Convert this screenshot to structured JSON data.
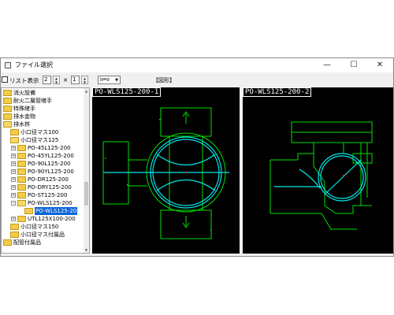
{
  "window": {
    "title": "ファイル選択",
    "minimize": "—",
    "maximize": "☐",
    "close": "✕"
  },
  "toolbar": {
    "list_view_label": "リスト表示",
    "columns": "2",
    "times": "×",
    "rows": "1",
    "format": "jpeg",
    "figure_label": "【図形】"
  },
  "tree": [
    {
      "label": "消火設備",
      "level": 0
    },
    {
      "label": "耐火二層管継手",
      "level": 0
    },
    {
      "label": "特殊継手",
      "level": 0
    },
    {
      "label": "排水金物",
      "level": 0
    },
    {
      "label": "排水桝",
      "level": 0,
      "open": true
    },
    {
      "label": "小口径マス100",
      "level": 1
    },
    {
      "label": "小口径マス125",
      "level": 1,
      "open": true
    },
    {
      "label": "PO-45L125-200",
      "level": 2,
      "expander": "+"
    },
    {
      "label": "PO-45YL125-200",
      "level": 2,
      "expander": "+"
    },
    {
      "label": "PO-90L125-200",
      "level": 2,
      "expander": "+"
    },
    {
      "label": "PO-90YL125-200",
      "level": 2,
      "expander": "+"
    },
    {
      "label": "PO-DR125-200",
      "level": 2,
      "expander": "+"
    },
    {
      "label": "PO-DRY125-200",
      "level": 2,
      "expander": "+"
    },
    {
      "label": "PO-ST125-200",
      "level": 2,
      "expander": "+"
    },
    {
      "label": "PO-WLS125-200",
      "level": 2,
      "expander": "−",
      "open": true
    },
    {
      "label": "PO-WLS125-20",
      "level": 3,
      "selected": true
    },
    {
      "label": "UTL125X100-200",
      "level": 2,
      "expander": "+"
    },
    {
      "label": "小口径マス150",
      "level": 1
    },
    {
      "label": "小口径マス付属品",
      "level": 1
    },
    {
      "label": "配管付属品",
      "level": 0
    }
  ],
  "views": [
    {
      "label": "PO-WLS125-200-1"
    },
    {
      "label": "PO-WLS125-200-2"
    }
  ],
  "colors": {
    "cad_green": "#00e000",
    "cad_cyan": "#00e8e8",
    "cad_red": "#ff2020",
    "selection": "#0a64d8"
  }
}
